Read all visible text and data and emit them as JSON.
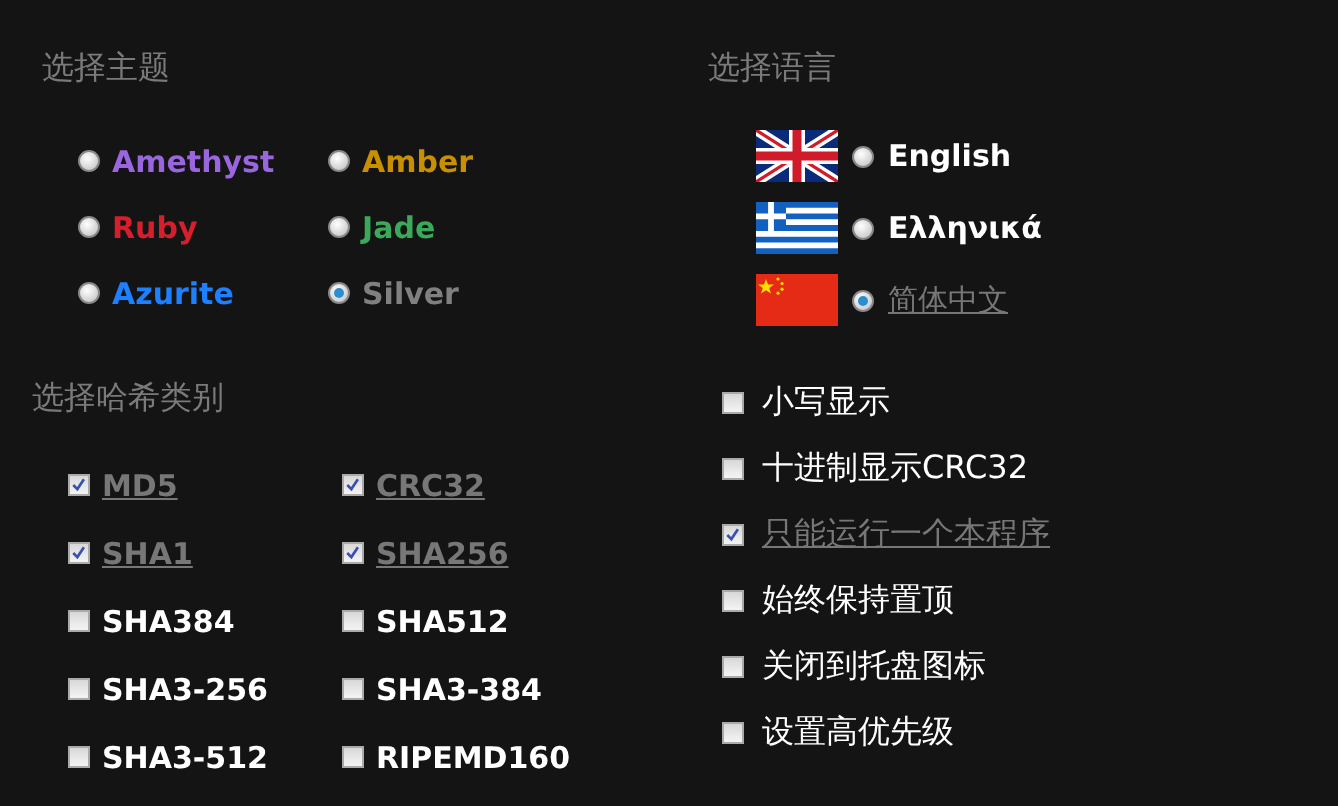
{
  "theme": {
    "title": "选择主题",
    "options": [
      {
        "label": "Amethyst",
        "color": "#9966dd",
        "selected": false
      },
      {
        "label": "Amber",
        "color": "#c89000",
        "selected": false
      },
      {
        "label": "Ruby",
        "color": "#d61f2c",
        "selected": false
      },
      {
        "label": "Jade",
        "color": "#3aaa5a",
        "selected": false
      },
      {
        "label": "Azurite",
        "color": "#1e7fff",
        "selected": false
      },
      {
        "label": "Silver",
        "color": "#808080",
        "selected": true
      }
    ]
  },
  "language": {
    "title": "选择语言",
    "options": [
      {
        "label": "English",
        "kind": "uk",
        "selected": false
      },
      {
        "label": "Ελληνικά",
        "kind": "greece",
        "selected": false
      },
      {
        "label": "简体中文",
        "kind": "china",
        "selected": true
      }
    ]
  },
  "hash": {
    "title": "选择哈希类别",
    "options": [
      {
        "label": "MD5",
        "checked": true
      },
      {
        "label": "CRC32",
        "checked": true
      },
      {
        "label": "SHA1",
        "checked": true
      },
      {
        "label": "SHA256",
        "checked": true
      },
      {
        "label": "SHA384",
        "checked": false
      },
      {
        "label": "SHA512",
        "checked": false
      },
      {
        "label": "SHA3-256",
        "checked": false
      },
      {
        "label": "SHA3-384",
        "checked": false
      },
      {
        "label": "SHA3-512",
        "checked": false
      },
      {
        "label": "RIPEMD160",
        "checked": false
      }
    ]
  },
  "settings": [
    {
      "label": "小写显示",
      "checked": false
    },
    {
      "label": "十进制显示CRC32",
      "checked": false
    },
    {
      "label": "只能运行一个本程序",
      "checked": true
    },
    {
      "label": "始终保持置顶",
      "checked": false
    },
    {
      "label": "关闭到托盘图标",
      "checked": false
    },
    {
      "label": "设置高优先级",
      "checked": false
    }
  ]
}
